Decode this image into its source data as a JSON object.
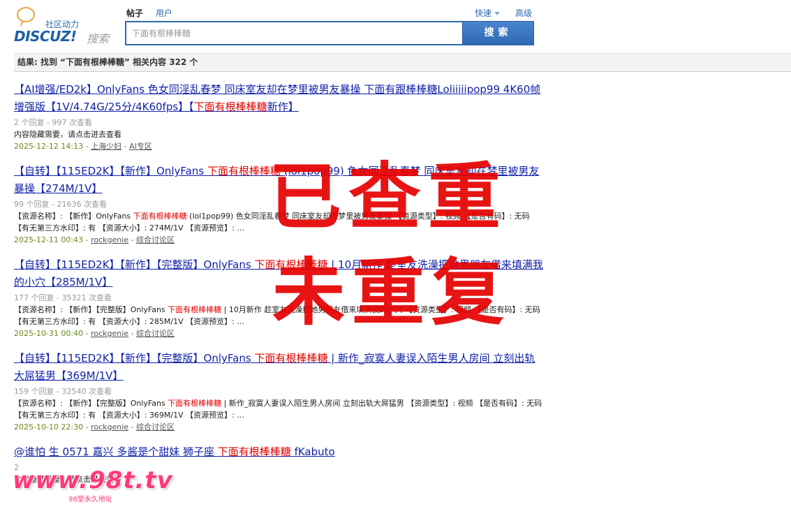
{
  "logo": {
    "tagline": "社区动力",
    "brand": "DISCUZ!",
    "sub": "搜索"
  },
  "tabs": [
    {
      "label": "帖子",
      "active": true
    },
    {
      "label": "用户",
      "active": false
    }
  ],
  "search": {
    "value": "下面有根棒棒糖",
    "button_label": "搜索",
    "quick_label": "快速",
    "advanced_label": "高级"
  },
  "result_summary": "结果: 找到 “下面有根棒棒糖” 相关内容 322 个",
  "results": [
    {
      "title_before": "【AI增强/ED2k】OnlyFans 色女同淫乱春梦 同床室友却在梦里被男友暴操 下面有跟棒棒糖Loliiiiipop99 4K60帧增强版【1V/4.74G/25分/4K60fps】【",
      "title_hl": "下面有根棒棒糖",
      "title_after": "新作】",
      "meta": "2 个回复 - 997 次查看",
      "summary_before": "内容隐藏需要，请点击进去查看",
      "summary_hl": "",
      "summary_after": "",
      "date": "2025-12-12 14:13",
      "author": "上海少妇",
      "forum": "AI专区"
    },
    {
      "title_before": "【自转】【115ED2K】【新作】OnlyFans ",
      "title_hl": "下面有根棒棒糖",
      "title_after": " (lol1pop99) 色女同淫乱春梦 同床室友却在梦里被男友暴操【274M/1V】",
      "meta": "99 个回复 - 21636 次查看",
      "summary_before": "【资源名称】: 【新作】OnlyFans ",
      "summary_hl": "下面有根棒棒糖",
      "summary_after": " (lol1pop99) 色女同淫乱春梦 同床室友却在梦里被男友暴操 【资源类型】: 视频 【是否有码】: 无码 【有无第三方水印】: 有 【资源大小】: 274M/1V 【资源预览】: ...",
      "date": "2025-12-11 00:43",
      "author": "rockgenie",
      "forum": "综合讨论区"
    },
    {
      "title_before": "【自转】【115ED2K】【新作】【完整版】OnlyFans ",
      "title_hl": "下面有根棒棒糖",
      "title_after": " | 10月新作 趁室友洗澡把她男朋友借来填满我的小穴【285M/1V】",
      "meta": "177 个回复 - 35321 次查看",
      "summary_before": "【资源名称】: 【新作】【完整版】OnlyFans ",
      "summary_hl": "下面有根棒棒糖",
      "summary_after": " | 10月新作 趁室友洗澡把她男朋友借来填满我的小穴 【资源类型】: 视频 【是否有码】: 无码 【有无第三方水印】: 有 【资源大小】: 285M/1V 【资源预览】: ...",
      "date": "2025-10-31 00:40",
      "author": "rockgenie",
      "forum": "综合讨论区"
    },
    {
      "title_before": "【自转】【115ED2K】【新作】【完整版】OnlyFans ",
      "title_hl": "下面有根棒棒糖",
      "title_after": " | 新作_寂寞人妻误入陌生男人房间 立刻出轨大屌猛男【369M/1V】",
      "meta": "159 个回复 - 32540 次查看",
      "summary_before": "【资源名称】: 【新作】【完整版】OnlyFans ",
      "summary_hl": "下面有根棒棒糖",
      "summary_after": " | 新作_寂寞人妻误入陌生男人房间 立刻出轨大屌猛男 【资源类型】: 视频 【是否有码】: 无码 【有无第三方水印】: 有 【资源大小】: 369M/1V 【资源预览】: ...",
      "date": "2025-10-10 22:30",
      "author": "rockgenie",
      "forum": "综合讨论区"
    },
    {
      "title_before": "@谁怕 生 0571  嘉兴 多酱是个甜妹 狮子座 ",
      "title_hl": "下面有根棒棒糖",
      "title_after": " fKabuto",
      "meta": "2",
      "summary_before": "内容隐藏需要，请点击进去查看",
      "summary_hl": "",
      "summary_after": "",
      "date": "",
      "author": "",
      "forum": ""
    }
  ],
  "overlay": {
    "line1": "已查重",
    "line2": "未重复",
    "color": "#e60000"
  },
  "watermark": {
    "text": "www.98t.tv",
    "sub": "98堂永久地址"
  }
}
